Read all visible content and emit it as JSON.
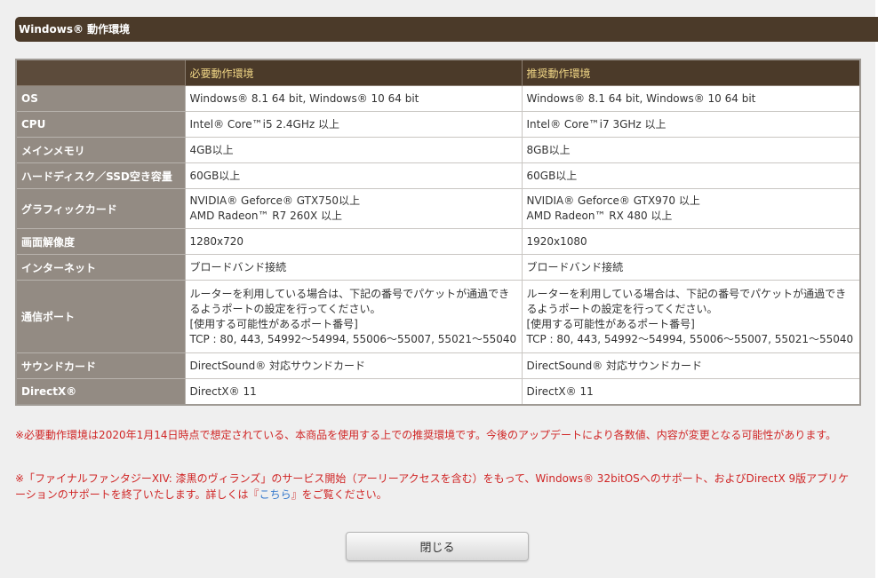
{
  "section_title": "Windows® 動作環境",
  "table": {
    "headers": {
      "required": "必要動作環境",
      "recommended": "推奨動作環境"
    },
    "rows": [
      {
        "label": "OS",
        "required": [
          "Windows® 8.1 64 bit, Windows® 10 64 bit"
        ],
        "recommended": [
          "Windows® 8.1 64 bit, Windows® 10 64 bit"
        ]
      },
      {
        "label": "CPU",
        "required": [
          "Intel® Core™i5 2.4GHz 以上"
        ],
        "recommended": [
          "Intel® Core™i7 3GHz 以上"
        ]
      },
      {
        "label": "メインメモリ",
        "required": [
          "4GB以上"
        ],
        "recommended": [
          "8GB以上"
        ]
      },
      {
        "label": "ハードディスク／SSD空き容量",
        "required": [
          "60GB以上"
        ],
        "recommended": [
          "60GB以上"
        ]
      },
      {
        "label": "グラフィックカード",
        "required": [
          "NVIDIA® Geforce® GTX750以上",
          "AMD Radeon™ R7 260X 以上"
        ],
        "recommended": [
          "NVIDIA® Geforce® GTX970 以上",
          "AMD Radeon™ RX 480 以上"
        ]
      },
      {
        "label": "画面解像度",
        "required": [
          "1280x720"
        ],
        "recommended": [
          "1920x1080"
        ]
      },
      {
        "label": "インターネット",
        "required": [
          "ブロードバンド接続"
        ],
        "recommended": [
          "ブロードバンド接続"
        ]
      },
      {
        "label": "通信ポート",
        "required": [
          "ルーターを利用している場合は、下記の番号でパケットが通過できるようポートの設定を行ってください。",
          "[使用する可能性があるポート番号]",
          "TCP : 80, 443, 54992～54994, 55006～55007, 55021～55040"
        ],
        "recommended": [
          "ルーターを利用している場合は、下記の番号でパケットが通過できるようポートの設定を行ってください。",
          "[使用する可能性があるポート番号]",
          "TCP : 80, 443, 54992～54994, 55006～55007, 55021～55040"
        ]
      },
      {
        "label": "サウンドカード",
        "required": [
          "DirectSound® 対応サウンドカード"
        ],
        "recommended": [
          "DirectSound® 対応サウンドカード"
        ]
      },
      {
        "label": "DirectX®",
        "required": [
          "DirectX® 11"
        ],
        "recommended": [
          "DirectX® 11"
        ]
      }
    ]
  },
  "notes": {
    "note1": "※必要動作環境は2020年1月14日時点で想定されている、本商品を使用する上での推奨環境です。今後のアップデートにより各数値、内容が変更となる可能性があります。",
    "note2_before": "※「ファイナルファンタジーXIV: 漆黒のヴィランズ」のサービス開始（アーリーアクセスを含む）をもって、Windows® 32bitOSへのサポート、およびDirectX 9版アプリケーションのサポートを終了いたします。詳しくは『",
    "note2_link": "こちら",
    "note2_after": "』をご覧ください。"
  },
  "close_button": "閉じる"
}
